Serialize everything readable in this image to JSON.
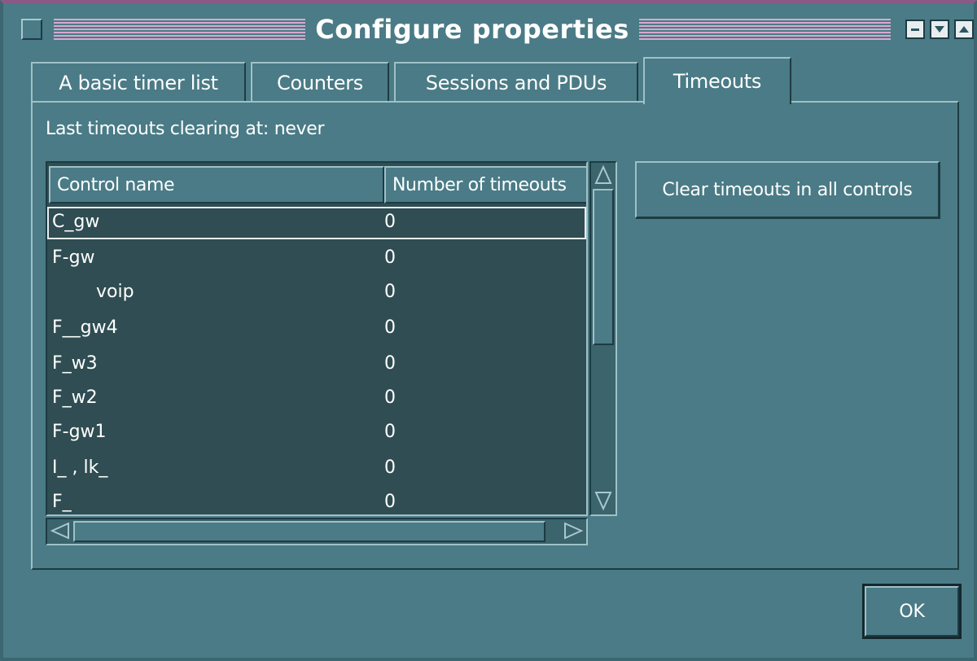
{
  "window": {
    "title": "Configure properties",
    "buttons": [
      "minimize-icon",
      "chevron-down-icon",
      "chevron-up-icon"
    ]
  },
  "tabs": [
    {
      "label": "A basic timer list",
      "active": false
    },
    {
      "label": "Counters",
      "active": false
    },
    {
      "label": "Sessions and PDUs",
      "active": false
    },
    {
      "label": "Timeouts",
      "active": true
    }
  ],
  "timeouts": {
    "last_cleared": "Last timeouts clearing at: never",
    "columns": [
      "Control name",
      "Number of timeouts"
    ],
    "rows": [
      {
        "name": "C_gw",
        "count": "0"
      },
      {
        "name": "F-gw",
        "count": "0"
      },
      {
        "name": "voip",
        "count": "0"
      },
      {
        "name": "F__gw4",
        "count": "0"
      },
      {
        "name": "F_w3",
        "count": "0"
      },
      {
        "name": "F_w2",
        "count": "0"
      },
      {
        "name": "F-gw1",
        "count": "0"
      },
      {
        "name": "I_ , lk_",
        "count": "0"
      },
      {
        "name": "F_",
        "count": "0"
      }
    ],
    "clear_button": "Clear timeouts in all controls"
  },
  "footer": {
    "ok_label": "OK"
  },
  "colors": {
    "background": "#4a7b86",
    "list_background": "#2f4d52",
    "title_stripes": "#d8a8d0"
  }
}
